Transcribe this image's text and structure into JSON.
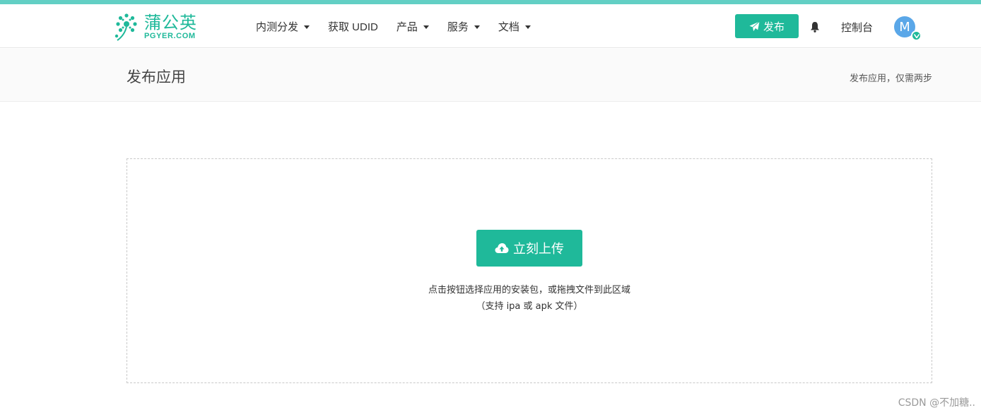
{
  "brand": {
    "name_cn": "蒲公英",
    "name_en": "PGYER.COM",
    "color": "#1fb99a"
  },
  "nav": {
    "items": [
      {
        "label": "内测分发",
        "has_dropdown": true
      },
      {
        "label": "获取 UDID",
        "has_dropdown": false
      },
      {
        "label": "产品",
        "has_dropdown": true
      },
      {
        "label": "服务",
        "has_dropdown": true
      },
      {
        "label": "文档",
        "has_dropdown": true
      }
    ]
  },
  "header": {
    "publish_label": "发布",
    "publish_icon": "paper-plane-icon",
    "bell_icon": "bell-icon",
    "console_label": "控制台",
    "avatar_letter": "M",
    "avatar_color": "#5aa7e8"
  },
  "page": {
    "title": "发布应用",
    "subtitle": "发布应用，仅需两步"
  },
  "upload": {
    "button_label": "立刻上传",
    "button_icon": "cloud-upload-icon",
    "hint_line1": "点击按钮选择应用的安装包，或拖拽文件到此区域",
    "hint_line2": "（支持 ipa 或 apk 文件）"
  },
  "watermark": "CSDN @不加糖.."
}
